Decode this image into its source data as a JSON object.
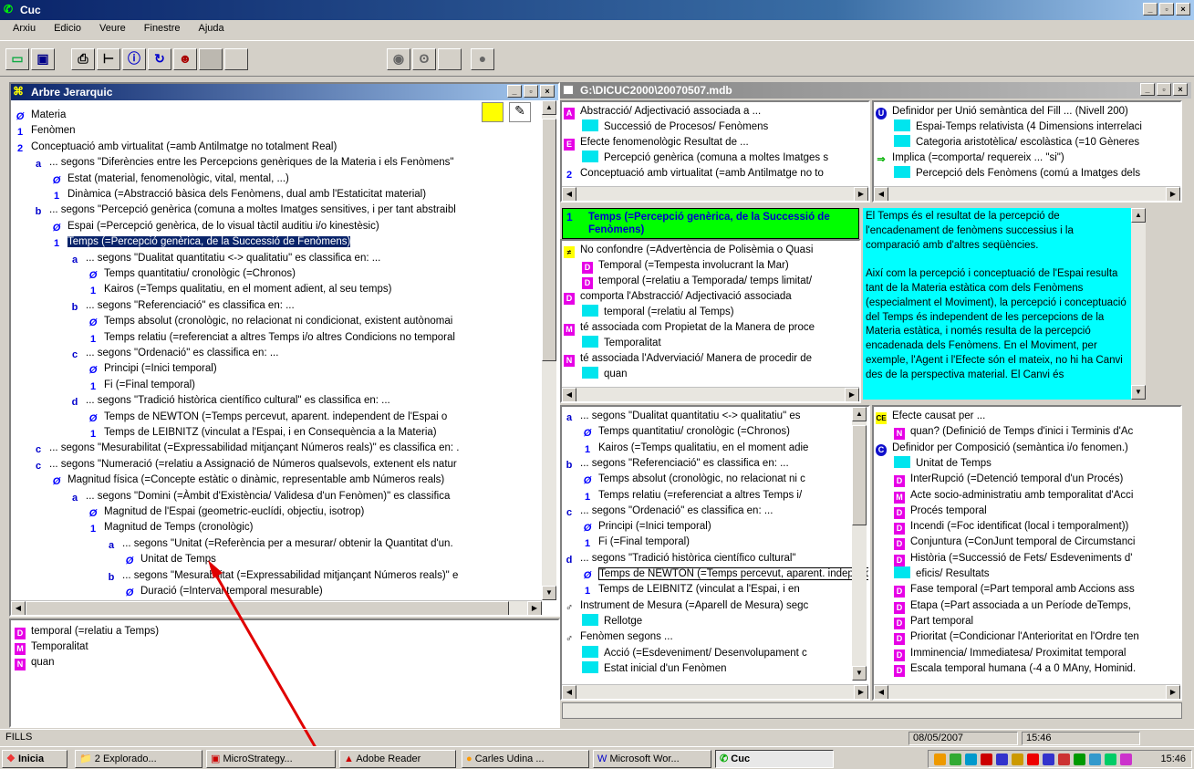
{
  "app": {
    "title": "Cuc",
    "menu": [
      "Arxiu",
      "Edicio",
      "Veure",
      "Finestre",
      "Ajuda"
    ]
  },
  "left_pane": {
    "title": "Arbre Jerarquic",
    "rows": [
      {
        "icon": "Ø",
        "text": "Materia"
      },
      {
        "icon": "1",
        "text": "Fenòmen"
      },
      {
        "icon": "2",
        "text": "Conceptuació amb virtualitat (=amb Antilmatge no totalment Real)"
      },
      {
        "icon": "a",
        "text": "... segons \"Diferències entre les Percepcions genèriques de la Materia i els Fenòmens\""
      },
      {
        "icon": "Ø",
        "text": "Estat (material, fenomenològic, vital, mental, ...)"
      },
      {
        "icon": "1",
        "text": "Dinàmica (=Abstracció bàsica dels Fenòmens, dual amb l'Estaticitat material)"
      },
      {
        "icon": "b",
        "text": "... segons \"Percepció genèrica (comuna a moltes Imatges sensitives, i per tant abstraibl"
      },
      {
        "icon": "Ø",
        "text": "Espai (=Percepció genèrica, de lo visual tàctil auditiu i/o kinestèsic)"
      },
      {
        "icon": "1",
        "text": "Temps (=Percepció genèrica, de la Successió de Fenòmens)"
      },
      {
        "icon": "a",
        "text": "... segons \"Dualitat quantitatiu <-> qualitatiu\" es classifica en: ..."
      },
      {
        "icon": "Ø",
        "text": "Temps quantitatiu/ cronològic (=Chronos)"
      },
      {
        "icon": "1",
        "text": "Kairos (=Temps qualitatiu, en el moment adient, al seu temps)"
      },
      {
        "icon": "b",
        "text": "... segons \"Referenciació\" es classifica en: ..."
      },
      {
        "icon": "Ø",
        "text": "Temps absolut (cronològic, no relacionat ni condicionat, existent autònomai"
      },
      {
        "icon": "1",
        "text": "Temps relatiu (=referenciat a altres Temps i/o altres Condicions no temporal"
      },
      {
        "icon": "c",
        "text": "... segons \"Ordenació\" es classifica en: ..."
      },
      {
        "icon": "Ø",
        "text": "Principi (=Inici temporal)"
      },
      {
        "icon": "1",
        "text": "Fi (=Final temporal)"
      },
      {
        "icon": "d",
        "text": "... segons \"Tradició històrica científico cultural\" es classifica en: ..."
      },
      {
        "icon": "Ø",
        "text": "Temps de NEWTON (=Temps percevut, aparent. independent de l'Espai o"
      },
      {
        "icon": "1",
        "text": "Temps de LEIBNITZ (vinculat a l'Espai, i en Consequència a la Materia)"
      },
      {
        "icon": "c",
        "text": "... segons \"Mesurabilitat (=Expressabilidad mitjançant Números reals)\" es classifica en: ."
      },
      {
        "icon": "c",
        "text": "... segons \"Numeració (=relatiu a Assignació de Números qualsevols, extenent els natur"
      },
      {
        "icon": "Ø",
        "text": "Magnitud física (=Concepte estàtic o dinàmic, representable amb Números reals)"
      },
      {
        "icon": "a",
        "text": "... segons \"Domini (=Àmbit d'Existència/ Validesa d'un Fenòmen)\" es classifica"
      },
      {
        "icon": "Ø",
        "text": "Magnitud de l'Espai (geometric-euclídi, objectiu, isotrop)"
      },
      {
        "icon": "1",
        "text": "Magnitud de Temps (cronològic)"
      },
      {
        "icon": "a",
        "text": "... segons \"Unitat (=Referència per a mesurar/ obtenir la Quantitat d'un."
      },
      {
        "icon": "Ø",
        "text": "Unitat de Temps"
      },
      {
        "icon": "b",
        "text": "... segons \"Mesurabilitat (=Expressabilidad mitjançant Números reals)\" e"
      },
      {
        "icon": "Ø",
        "text": "Duració (=Interval temporal mesurable)"
      }
    ]
  },
  "left_bottom": {
    "rows": [
      {
        "icon": "D",
        "text": "temporal (=relatiu a Temps)"
      },
      {
        "icon": "M",
        "text": "Temporalitat"
      },
      {
        "icon": "N",
        "text": "quan"
      }
    ]
  },
  "right_window": {
    "title": "G:\\DICUC2000\\20070507.mdb"
  },
  "q1": {
    "rows": [
      {
        "icon": "A",
        "text": "Abstracció/ Adjectivació associada a ..."
      },
      {
        "icon": "",
        "text": "Successió de Procesos/ Fenòmens"
      },
      {
        "icon": "E",
        "text": "Efecte fenomenològic Resultat de ..."
      },
      {
        "icon": "",
        "text": "Percepció genèrica (comuna a moltes Imatges s"
      },
      {
        "icon": "2",
        "text": "Conceptuació amb virtualitat (=amb Antilmatge no to"
      }
    ]
  },
  "q2": {
    "rows": [
      {
        "icon": "U",
        "text": "Definidor per Unió semàntica del Fill ... (Nivell 200)"
      },
      {
        "icon": "",
        "text": "Espai-Temps relativista (4 Dimensions interrelaci"
      },
      {
        "icon": "",
        "text": "Categoria aristotèlica/ escolàstica (=10 Gèneres"
      },
      {
        "icon": "⇒",
        "text": "Implica (=comporta/ requereix ... \"si\")"
      },
      {
        "icon": "",
        "text": "Percepció dels Fenòmens (comú a Imatges dels"
      }
    ]
  },
  "band": {
    "icon": "1",
    "text": "Temps (=Percepció genèrica, de la Successió de Fenòmens)"
  },
  "q3": {
    "rows": [
      {
        "icon": "≠",
        "text": "No confondre (=Advertència de Polisèmia o Quasi"
      },
      {
        "icon": "D",
        "text": "Temporal (=Tempesta involucrant la Mar)"
      },
      {
        "icon": "D",
        "text": "temporal (=relatiu a Temporada/ temps limitat/"
      },
      {
        "icon": "D",
        "text": "comporta l'Abstracció/ Adjectivació associada"
      },
      {
        "icon": "",
        "text": "temporal (=relatiu al Temps)"
      },
      {
        "icon": "M",
        "text": "té associada com Propietat de la Manera de proce"
      },
      {
        "icon": "",
        "text": "Temporalitat"
      },
      {
        "icon": "N",
        "text": "té associada l'Adverviació/ Manera de procedir de"
      },
      {
        "icon": "",
        "text": "quan"
      }
    ]
  },
  "description": "El Temps és el resultat de la percepció de l'encadenament de fenòmens successius i la comparació amb d'altres seqüències.\n\nAixí com la percepció i conceptuació de l'Espai resulta tant de la Materia estàtica com dels Fenòmens (especialment el Moviment), la percepció i conceptuació del Temps és independent de les percepcions de la Materia estàtica, i només resulta de la percepció encadenada dels Fenòmens. En el Moviment, per exemple, l'Agent i l'Efecte són el mateix, no hi ha Canvi des de la perspectiva material. El Canvi és",
  "q5": {
    "rows": [
      {
        "icon": "a",
        "text": "... segons \"Dualitat quantitatiu <-> qualitatiu\" es"
      },
      {
        "icon": "Ø",
        "text": "Temps quantitatiu/ cronològic (=Chronos)"
      },
      {
        "icon": "1",
        "text": "Kairos (=Temps qualitatiu, en el moment adie"
      },
      {
        "icon": "b",
        "text": "... segons \"Referenciació\" es classifica en: ..."
      },
      {
        "icon": "Ø",
        "text": "Temps absolut (cronològic, no relacionat ni c"
      },
      {
        "icon": "1",
        "text": "Temps relatiu (=referenciat a altres Temps i/"
      },
      {
        "icon": "c",
        "text": "... segons \"Ordenació\" es classifica en: ..."
      },
      {
        "icon": "Ø",
        "text": "Principi (=Inici temporal)"
      },
      {
        "icon": "1",
        "text": "Fi (=Final temporal)"
      },
      {
        "icon": "d",
        "text": "... segons \"Tradició històrica científico cultural\""
      },
      {
        "icon": "Ø",
        "text": "Temps de NEWTON (=Temps percevut, aparent. independent de l'Espai o d'altre Cosa"
      },
      {
        "icon": "1",
        "text": "Temps de LEIBNITZ (vinculat a l'Espai, i en"
      },
      {
        "icon": "♂",
        "text": "Instrument de Mesura (=Aparell de Mesura) segc"
      },
      {
        "icon": "",
        "text": "Rellotge"
      },
      {
        "icon": "♂",
        "text": "Fenòmen segons ..."
      },
      {
        "icon": "",
        "text": "Acció (=Esdeveniment/ Desenvolupament c"
      },
      {
        "icon": "",
        "text": "Estat inicial d'un Fenòmen"
      }
    ]
  },
  "q6": {
    "rows": [
      {
        "icon": "CE",
        "text": "Efecte causat per ..."
      },
      {
        "icon": "N",
        "text": "quan? (Definició de Temps d'inici i Terminis d'Ac"
      },
      {
        "icon": "C",
        "text": "Definidor per Composició (semàntica i/o fenomen.)"
      },
      {
        "icon": "",
        "text": "Unitat de Temps"
      },
      {
        "icon": "D",
        "text": "InterRupció (=Detenció temporal d'un Procés)"
      },
      {
        "icon": "M",
        "text": "Acte socio-administratiu amb temporalitat d'Acci"
      },
      {
        "icon": "D",
        "text": "Procés temporal"
      },
      {
        "icon": "D",
        "text": "Incendi (=Foc identificat (local i temporalment))"
      },
      {
        "icon": "D",
        "text": "Conjuntura (=ConJunt temporal de Circumstanci"
      },
      {
        "icon": "D",
        "text": "Història (=Successió de Fets/ Esdeveniments d'"
      },
      {
        "icon": "",
        "text": "eficis/ Resultats"
      },
      {
        "icon": "D",
        "text": "Fase temporal (=Part temporal amb Accions ass"
      },
      {
        "icon": "D",
        "text": "Etapa (=Part associada a un Període deTemps,"
      },
      {
        "icon": "D",
        "text": "Part temporal"
      },
      {
        "icon": "D",
        "text": "Prioritat (=Condicionar l'Anterioritat en l'Ordre ten"
      },
      {
        "icon": "D",
        "text": "Imminencia/ Immediatesa/ Proximitat temporal"
      },
      {
        "icon": "D",
        "text": "Escala temporal humana (-4 a 0 MAny, Hominid."
      }
    ]
  },
  "status": {
    "left": "FILLS",
    "date": "08/05/2007",
    "time": "15:46"
  },
  "taskbar": {
    "start": "Inicia",
    "tasks": [
      "2 Explorado...",
      "MicroStrategy...",
      "Adobe Reader",
      "Carles Udina ...",
      "Microsoft Wor...",
      "Cuc"
    ],
    "clock": "15:46"
  }
}
